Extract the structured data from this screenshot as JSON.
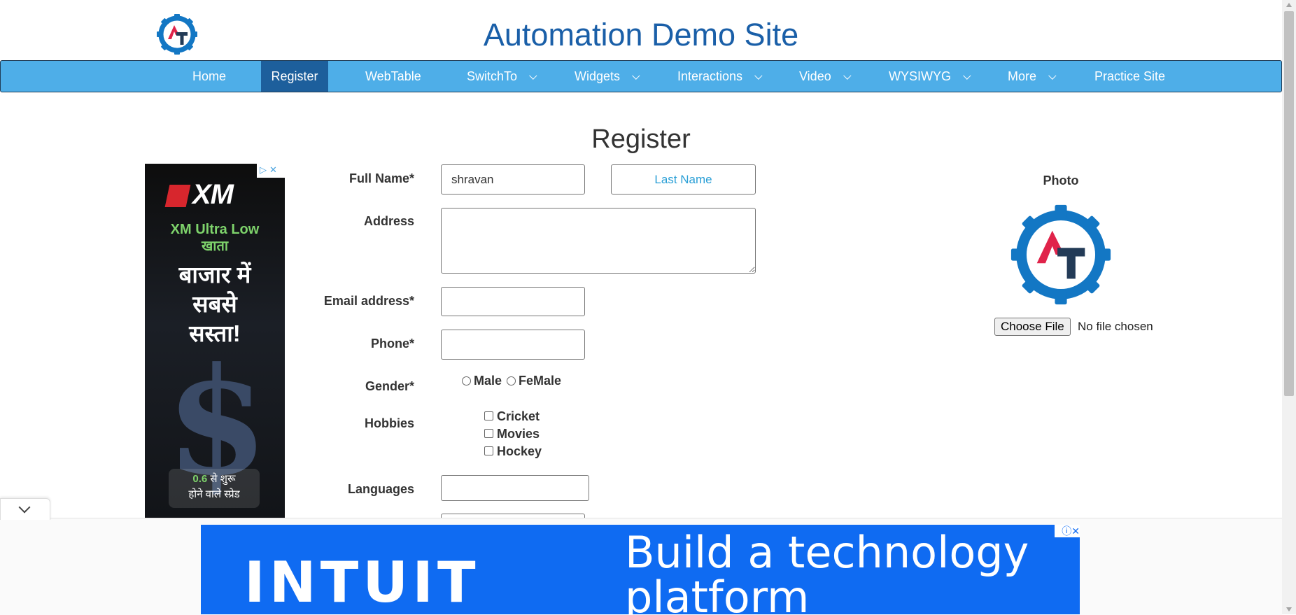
{
  "site": {
    "title": "Automation Demo Site"
  },
  "nav": {
    "items": [
      {
        "label": "Home"
      },
      {
        "label": "Register",
        "active": true
      },
      {
        "label": "WebTable"
      },
      {
        "label": "SwitchTo",
        "dropdown": true
      },
      {
        "label": "Widgets",
        "dropdown": true
      },
      {
        "label": "Interactions",
        "dropdown": true
      },
      {
        "label": "Video",
        "dropdown": true
      },
      {
        "label": "WYSIWYG",
        "dropdown": true
      },
      {
        "label": "More",
        "dropdown": true
      },
      {
        "label": "Practice Site"
      }
    ]
  },
  "page": {
    "heading": "Register"
  },
  "form": {
    "full_name_label": "Full Name*",
    "first_name_value": "shravan",
    "last_name_placeholder": "Last Name",
    "address_label": "Address",
    "address_value": "",
    "email_label": "Email address*",
    "phone_label": "Phone*",
    "gender_label": "Gender*",
    "gender_options": [
      "Male",
      "FeMale"
    ],
    "hobbies_label": "Hobbies",
    "hobbies": [
      "Cricket",
      "Movies",
      "Hockey"
    ],
    "languages_label": "Languages"
  },
  "photo": {
    "label": "Photo",
    "choose_file": "Choose File",
    "status": "No file chosen"
  },
  "side_ad": {
    "brand": "XM",
    "line1": "XM Ultra Low",
    "line2": "खाता",
    "headline": [
      "बाजार में",
      "सबसे",
      "सस्ता!"
    ],
    "badge_value": "0.6",
    "badge_text_1": "से शुरू",
    "badge_text_2": "होने वाले स्प्रेड"
  },
  "bottom_ad": {
    "brand": "INTUIT",
    "message_line1": "Build a technology",
    "message_line2": "platform"
  },
  "colors": {
    "nav_bg": "#4eaee8",
    "nav_active": "#1d5f9c",
    "title": "#1a5fa8",
    "ad_blue": "#0f6bf2"
  }
}
